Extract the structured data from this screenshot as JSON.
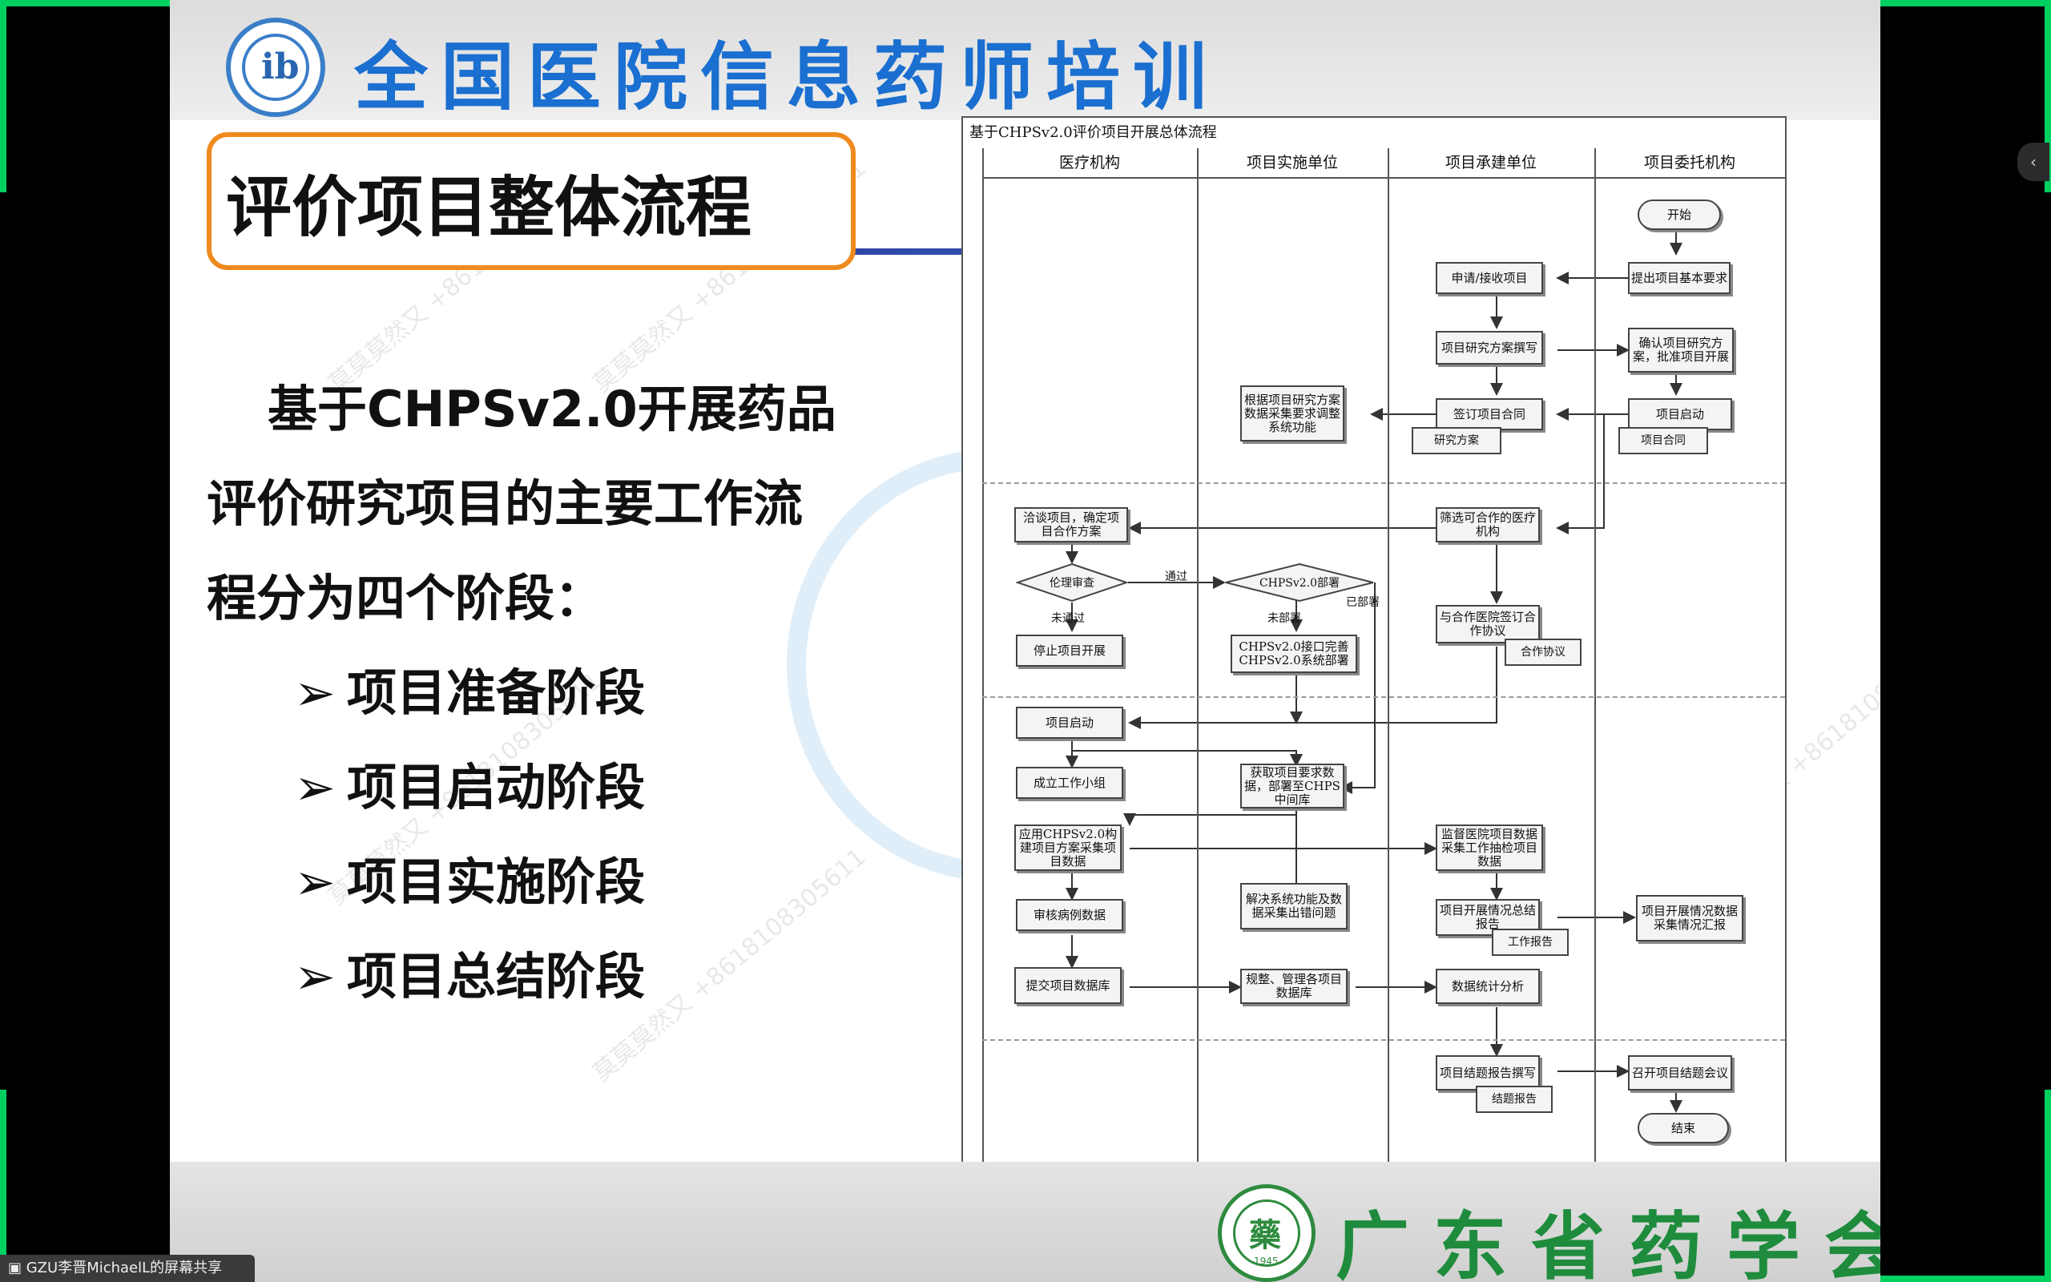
{
  "colors": {
    "banner_blue": "#1a6fd0",
    "title_border": "#f08a1e",
    "footer_green": "#1e8c3c",
    "corner_green": "#00d060"
  },
  "header": {
    "banner": "全国医院信息药师培训"
  },
  "slide": {
    "title": "评价项目整体流程",
    "intro_lines": [
      "基于CHPSv2.0开展药品",
      "评价研究项目的主要工作流",
      "程分为四个阶段："
    ],
    "stages": [
      {
        "arrow": "➢",
        "label": "项目准备阶段"
      },
      {
        "arrow": "➢",
        "label": "项目启动阶段"
      },
      {
        "arrow": "➢",
        "label": "项目实施阶段"
      },
      {
        "arrow": "➢",
        "label": "项目总结阶段"
      }
    ]
  },
  "watermark": {
    "text": "莫莫莫然又 +8618108305611"
  },
  "flowchart": {
    "title": "基于CHPSv2.0评价项目开展总体流程",
    "lanes": [
      "医疗机构",
      "项目实施单位",
      "项目承建单位",
      "项目委托机构"
    ],
    "nodes": {
      "start": "开始",
      "submit_req": "提出项目基本要求",
      "apply": "申请/接收项目",
      "draft_plan": "项目研究方案撰写",
      "confirm_plan": "确认项目研究方案，批准项目开展",
      "adjust_system": "根据项目研究方案数据采集要求调整系统功能",
      "sign_contract": "签订项目合同",
      "launch": "项目启动",
      "research_plan_doc": "研究方案",
      "contract_doc": "项目合同",
      "negotiate": "洽谈项目，确定项目合作方案",
      "screen_hospital": "筛选可合作的医疗机构",
      "ethics": "伦理审查",
      "pass": "通过",
      "chps_deploy": "CHPSv2.0部署",
      "deployed": "已部署",
      "not_passed": "未通过",
      "not_deployed": "未部署",
      "stop": "停止项目开展",
      "interface_deploy": "CHPSv2.0接口完善 CHPSv2.0系统部署",
      "sign_agreement": "与合作医院签订合作协议",
      "agreement_doc": "合作协议",
      "project_launch": "项目启动",
      "form_team": "成立工作小组",
      "get_data": "获取项目要求数据，部署至CHPS中间库",
      "apply_chps": "应用CHPSv2.0构建项目方案采集项目数据",
      "supervise": "监督医院项目数据采集工作抽检项目数据",
      "audit_cases": "审核病例数据",
      "solve_issues": "解决系统功能及数据采集出错问题",
      "progress_summary": "项目开展情况总结报告",
      "work_report_doc": "工作报告",
      "progress_report": "项目开展情况数据采集情况汇报",
      "submit_db": "提交项目数据库",
      "organize_db": "规整、管理各项目数据库",
      "stats": "数据统计分析",
      "final_report": "项目结题报告撰写",
      "final_report_doc": "结题报告",
      "final_meeting": "召开项目结题会议",
      "end": "结束"
    }
  },
  "footer": {
    "org": "广东省药学会",
    "seal_year": "1945",
    "seal_char": "藥"
  },
  "taskbar": {
    "share_label": "GZU李晋MichaelL的屏幕共享",
    "side_arrow": "‹"
  }
}
